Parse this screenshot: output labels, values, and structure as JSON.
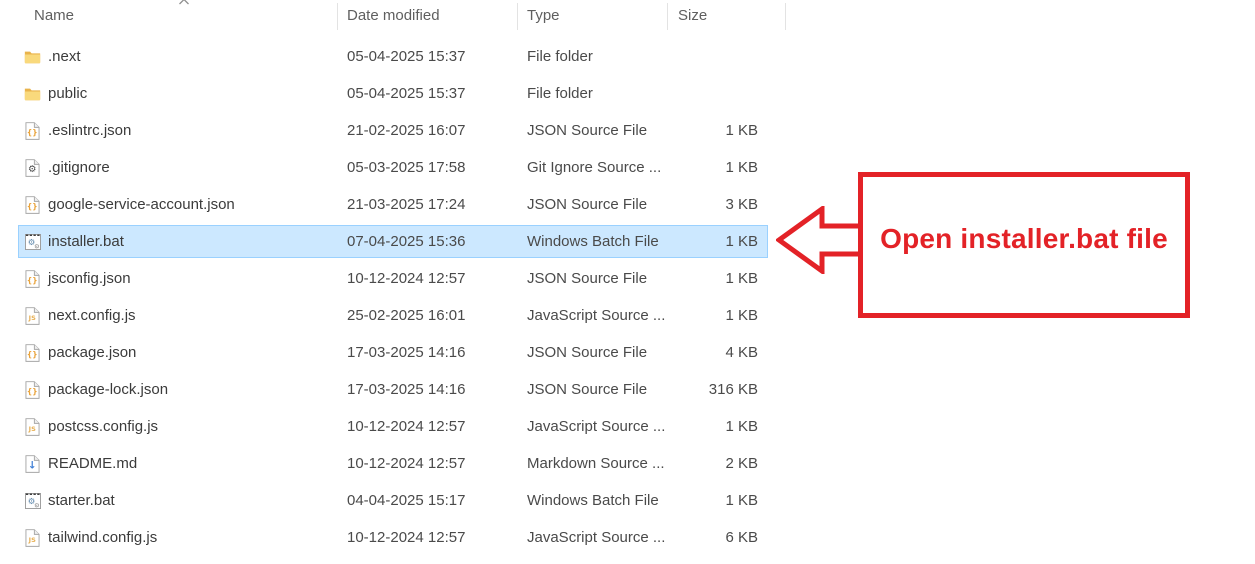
{
  "file_list": {
    "columns": [
      {
        "id": "name",
        "label": "Name",
        "sort": "ascending"
      },
      {
        "id": "date",
        "label": "Date modified",
        "sort": "none"
      },
      {
        "id": "type",
        "label": "Type",
        "sort": "none"
      },
      {
        "id": "size",
        "label": "Size",
        "sort": "none"
      }
    ],
    "rows": [
      {
        "name": ".next",
        "icon": "folder-icon",
        "date": "05-04-2025 15:37",
        "type": "File folder",
        "size": "",
        "selected": false
      },
      {
        "name": "public",
        "icon": "folder-icon",
        "date": "05-04-2025 15:37",
        "type": "File folder",
        "size": "",
        "selected": false
      },
      {
        "name": ".eslintrc.json",
        "icon": "json-file-icon",
        "date": "21-02-2025 16:07",
        "type": "JSON Source File",
        "size": "1 KB",
        "selected": false
      },
      {
        "name": ".gitignore",
        "icon": "gear-file-icon",
        "date": "05-03-2025 17:58",
        "type": "Git Ignore Source ...",
        "size": "1 KB",
        "selected": false
      },
      {
        "name": "google-service-account.json",
        "icon": "json-file-icon",
        "date": "21-03-2025 17:24",
        "type": "JSON Source File",
        "size": "3 KB",
        "selected": false
      },
      {
        "name": "installer.bat",
        "icon": "batch-file-icon",
        "date": "07-04-2025 15:36",
        "type": "Windows Batch File",
        "size": "1 KB",
        "selected": true
      },
      {
        "name": "jsconfig.json",
        "icon": "json-file-icon",
        "date": "10-12-2024 12:57",
        "type": "JSON Source File",
        "size": "1 KB",
        "selected": false
      },
      {
        "name": "next.config.js",
        "icon": "js-file-icon",
        "date": "25-02-2025 16:01",
        "type": "JavaScript Source ...",
        "size": "1 KB",
        "selected": false
      },
      {
        "name": "package.json",
        "icon": "json-file-icon",
        "date": "17-03-2025 14:16",
        "type": "JSON Source File",
        "size": "4 KB",
        "selected": false
      },
      {
        "name": "package-lock.json",
        "icon": "json-file-icon",
        "date": "17-03-2025 14:16",
        "type": "JSON Source File",
        "size": "316 KB",
        "selected": false
      },
      {
        "name": "postcss.config.js",
        "icon": "js-file-icon",
        "date": "10-12-2024 12:57",
        "type": "JavaScript Source ...",
        "size": "1 KB",
        "selected": false
      },
      {
        "name": "README.md",
        "icon": "markdown-file-icon",
        "date": "10-12-2024 12:57",
        "type": "Markdown Source ...",
        "size": "2 KB",
        "selected": false
      },
      {
        "name": "starter.bat",
        "icon": "batch-file-icon",
        "date": "04-04-2025 15:17",
        "type": "Windows Batch File",
        "size": "1 KB",
        "selected": false
      },
      {
        "name": "tailwind.config.js",
        "icon": "js-file-icon",
        "date": "10-12-2024 12:57",
        "type": "JavaScript Source ...",
        "size": "6 KB",
        "selected": false
      }
    ]
  },
  "annotation": {
    "label": "Open installer.bat file"
  },
  "colors": {
    "annotation_red": "#e32227",
    "selection_bg": "#cce8ff",
    "selection_border": "#9ad1ff"
  }
}
